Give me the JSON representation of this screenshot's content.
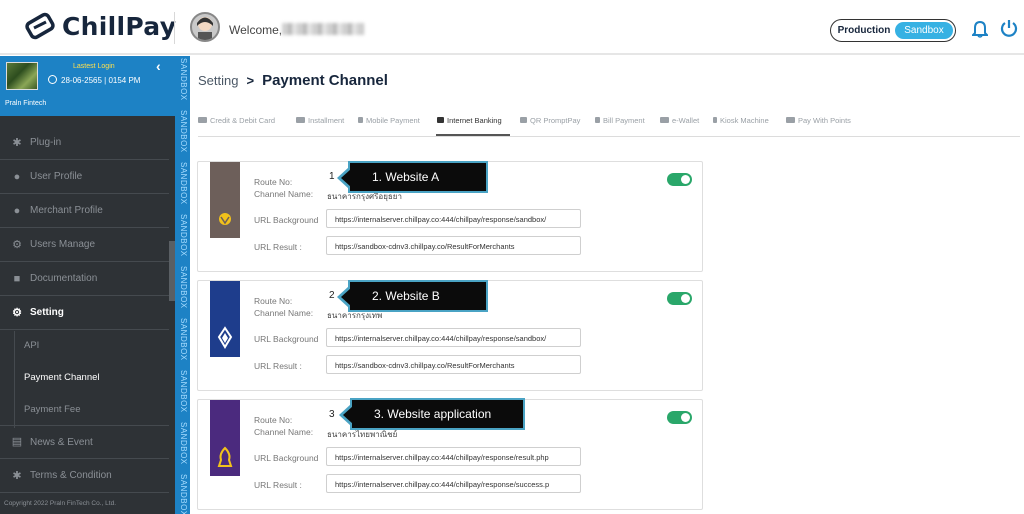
{
  "header": {
    "logo_text": "ChillPay",
    "welcome_text": "Welcome,",
    "env_production": "Production",
    "env_sandbox": "Sandbox"
  },
  "sidebar": {
    "last_login_label": "Lastest Login",
    "last_login_time": "28-06-2565 | 0154 PM",
    "company": "Praln Fintech",
    "items": [
      {
        "label": "Plug-in",
        "icon": "puzzle-icon"
      },
      {
        "label": "User Profile",
        "icon": "user-icon"
      },
      {
        "label": "Merchant Profile",
        "icon": "users-icon"
      },
      {
        "label": "Users Manage",
        "icon": "users-gear-icon"
      },
      {
        "label": "Documentation",
        "icon": "folder-icon"
      },
      {
        "label": "Setting",
        "icon": "gears-icon"
      },
      {
        "label": "News & Event",
        "icon": "newspaper-icon"
      },
      {
        "label": "Terms & Condition",
        "icon": "asterisk-icon"
      }
    ],
    "sub_items": [
      "API",
      "Payment Channel",
      "Payment Fee"
    ],
    "copyright": "Copyright 2022 Praln FinTech Co., Ltd."
  },
  "stripe": {
    "label": "SANDBOX"
  },
  "breadcrumb": {
    "parent": "Setting",
    "separator": ">",
    "current": "Payment Channel"
  },
  "tabs": [
    "Credit & Debit Card",
    "Installment",
    "Mobile Payment",
    "Internet Banking",
    "QR PromptPay",
    "Bill Payment",
    "e-Wallet",
    "Kiosk Machine",
    "Pay With Points"
  ],
  "active_tab": "Internet Banking",
  "form_labels": {
    "route_no": "Route No:",
    "channel_name": "Channel Name:",
    "url_background": "URL Background",
    "url_result": "URL Result :"
  },
  "channels": [
    {
      "route_no": "1",
      "channel_name": "ธนาคารกรุงศรีอยุธยา",
      "url_background": "https://internalserver.chillpay.co:444/chillpay/response/sandbox/",
      "url_result": "https://sandbox-cdnv3.chillpay.co/ResultForMerchants",
      "enabled": true,
      "callout": "1. Website A",
      "logo_color": "#6d5f5a"
    },
    {
      "route_no": "2",
      "channel_name": "ธนาคารกรุงเทพ",
      "url_background": "https://internalserver.chillpay.co:444/chillpay/response/sandbox/",
      "url_result": "https://sandbox-cdnv3.chillpay.co/ResultForMerchants",
      "enabled": true,
      "callout": "2. Website B",
      "logo_color": "#1e3d8c"
    },
    {
      "route_no": "3",
      "channel_name": "ธนาคารไทยพาณิชย์",
      "url_background": "https://internalserver.chillpay.co:444/chillpay/response/result.php",
      "url_result": "https://internalserver.chillpay.co:444/chillpay/response/success.p",
      "enabled": true,
      "callout": "3. Website application",
      "logo_color": "#4b2a7e"
    }
  ],
  "colors": {
    "brand_blue": "#1d82c5",
    "sandbox_blue": "#36b1e3",
    "toggle_green": "#2aa76a",
    "sidebar_bg": "#2e3236"
  }
}
